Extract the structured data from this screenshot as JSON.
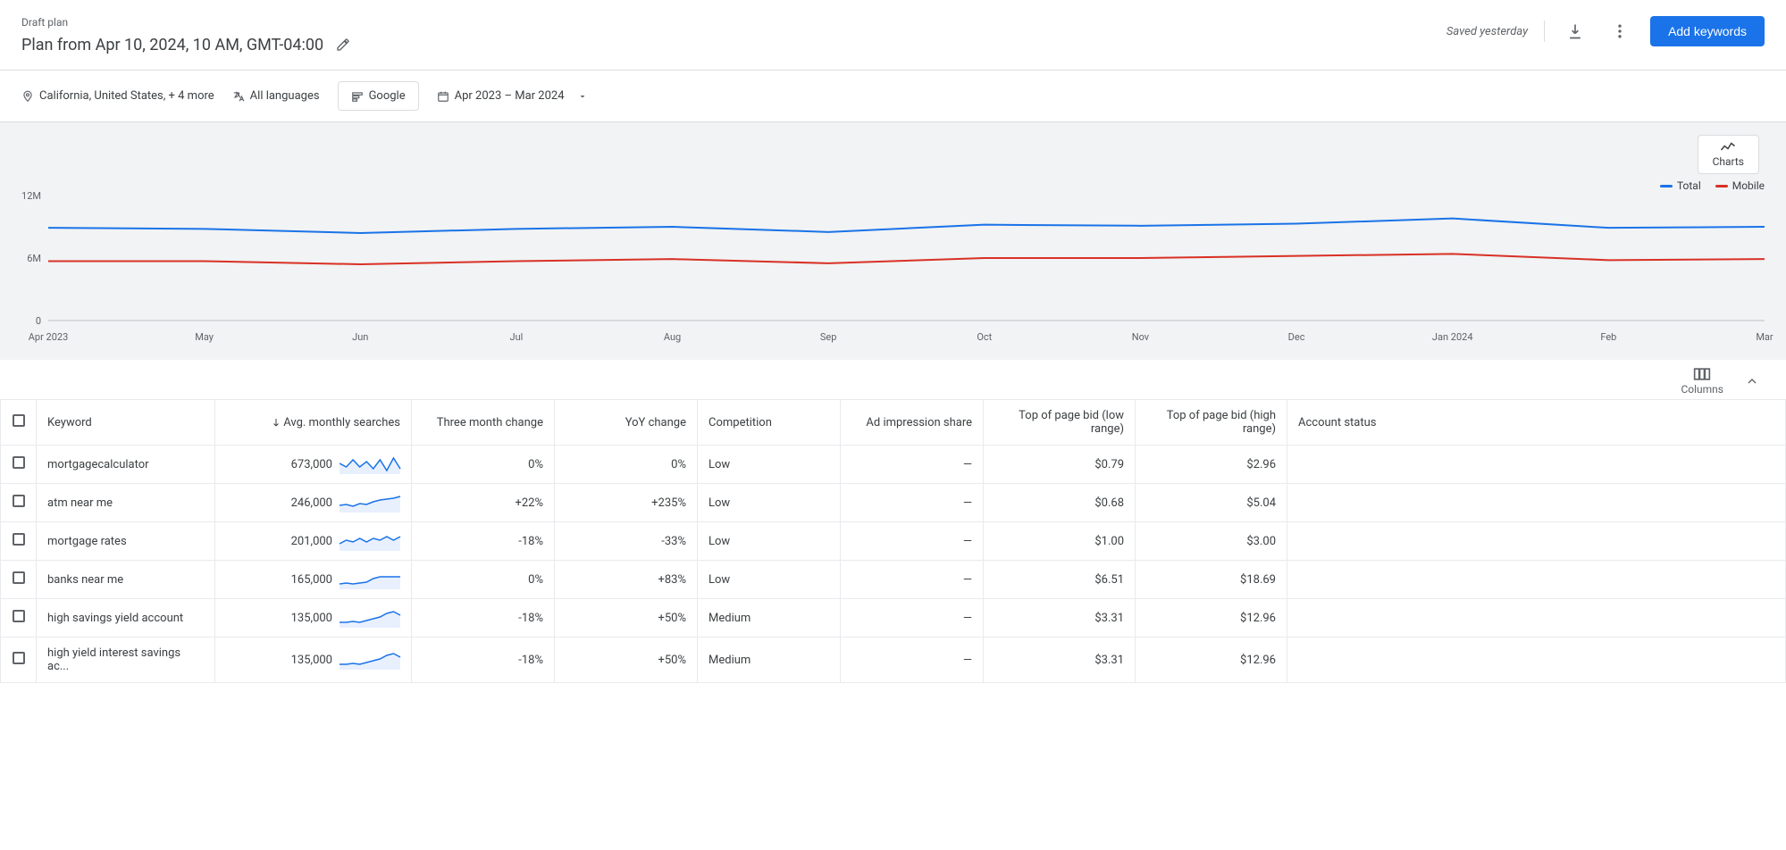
{
  "header": {
    "label": "Draft plan",
    "title": "Plan from Apr 10, 2024, 10 AM, GMT-04:00",
    "saved": "Saved yesterday",
    "add_btn": "Add keywords"
  },
  "filters": {
    "location": "California, United States, + 4 more",
    "language": "All languages",
    "network": "Google",
    "date_range": "Apr 2023 – Mar 2024"
  },
  "charts_btn": "Charts",
  "legend": {
    "total": "Total",
    "mobile": "Mobile"
  },
  "chart_data": {
    "type": "line",
    "x_labels": [
      "Apr 2023",
      "May",
      "Jun",
      "Jul",
      "Aug",
      "Sep",
      "Oct",
      "Nov",
      "Dec",
      "Jan 2024",
      "Feb",
      "Mar"
    ],
    "y_ticks": [
      "0",
      "6M",
      "12M"
    ],
    "ylim": [
      0,
      12000000
    ],
    "series": [
      {
        "name": "Total",
        "color": "#1a73e8",
        "values": [
          8900000,
          8800000,
          8400000,
          8800000,
          9000000,
          8500000,
          9200000,
          9100000,
          9300000,
          9800000,
          8900000,
          9000000
        ]
      },
      {
        "name": "Mobile",
        "color": "#d93025",
        "values": [
          5700000,
          5700000,
          5400000,
          5700000,
          5900000,
          5500000,
          6000000,
          6000000,
          6200000,
          6400000,
          5800000,
          5900000
        ]
      }
    ]
  },
  "columns_label": "Columns",
  "table": {
    "headers": {
      "keyword": "Keyword",
      "avg": "Avg. monthly searches",
      "three_mo": "Three month change",
      "yoy": "YoY change",
      "competition": "Competition",
      "ad_share": "Ad impression share",
      "bid_low": "Top of page bid (low range)",
      "bid_high": "Top of page bid (high range)",
      "account": "Account status"
    },
    "rows": [
      {
        "keyword": "mortgagecalculator",
        "avg": "673,000",
        "three_mo": "0%",
        "yoy": "0%",
        "competition": "Low",
        "ad_share": "—",
        "bid_low": "$0.79",
        "bid_high": "$2.96",
        "spark": [
          10,
          14,
          6,
          14,
          8,
          16,
          6,
          18,
          4,
          16
        ]
      },
      {
        "keyword": "atm near me",
        "avg": "246,000",
        "three_mo": "+22%",
        "yoy": "+235%",
        "competition": "Low",
        "ad_share": "—",
        "bid_low": "$0.68",
        "bid_high": "$5.04",
        "spark": [
          14,
          13,
          15,
          12,
          13,
          10,
          8,
          7,
          6,
          4
        ]
      },
      {
        "keyword": "mortgage rates",
        "avg": "201,000",
        "three_mo": "-18%",
        "yoy": "-33%",
        "competition": "Low",
        "ad_share": "—",
        "bid_low": "$1.00",
        "bid_high": "$3.00",
        "spark": [
          14,
          10,
          12,
          8,
          12,
          8,
          10,
          6,
          10,
          6
        ]
      },
      {
        "keyword": "banks near me",
        "avg": "165,000",
        "three_mo": "0%",
        "yoy": "+83%",
        "competition": "Low",
        "ad_share": "—",
        "bid_low": "$6.51",
        "bid_high": "$18.69",
        "spark": [
          16,
          15,
          16,
          15,
          14,
          10,
          8,
          8,
          8,
          8
        ]
      },
      {
        "keyword": "high savings yield account",
        "avg": "135,000",
        "three_mo": "-18%",
        "yoy": "+50%",
        "competition": "Medium",
        "ad_share": "—",
        "bid_low": "$3.31",
        "bid_high": "$12.96",
        "spark": [
          16,
          16,
          15,
          16,
          14,
          12,
          10,
          6,
          4,
          8
        ]
      },
      {
        "keyword": "high yield interest savings ac...",
        "avg": "135,000",
        "three_mo": "-18%",
        "yoy": "+50%",
        "competition": "Medium",
        "ad_share": "—",
        "bid_low": "$3.31",
        "bid_high": "$12.96",
        "spark": [
          16,
          16,
          15,
          16,
          14,
          12,
          10,
          6,
          4,
          8
        ]
      }
    ]
  }
}
